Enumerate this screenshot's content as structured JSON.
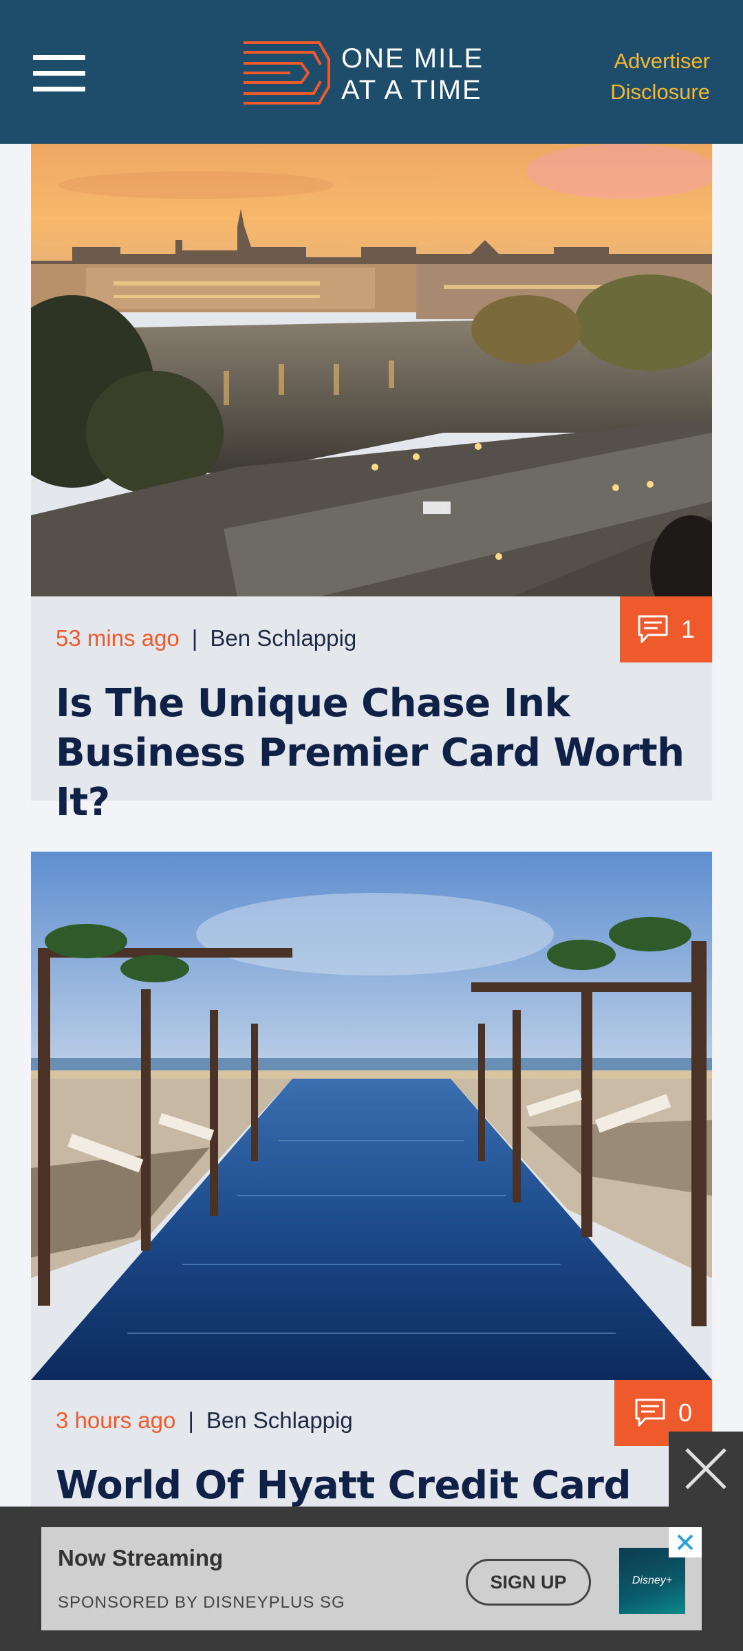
{
  "header": {
    "brand_line1": "ONE MILE",
    "brand_line2": "AT A TIME",
    "advertiser_line1": "Advertiser",
    "advertiser_line2": "Disclosure"
  },
  "articles": [
    {
      "time": "53 mins ago",
      "separator": "|",
      "author": "Ben Schlappig",
      "comments": "1",
      "title_line1": "Is The Unique Chase Ink",
      "title_line2": "Business Premier Card Worth It?",
      "image": "paris-seine-sunset"
    },
    {
      "time": "3 hours ago",
      "separator": "|",
      "author": "Ben Schlappig",
      "comments": "0",
      "title_line1": "World Of Hyatt Credit Card",
      "image": "resort-pool-cabanas"
    }
  ],
  "ad": {
    "title": "Now Streaming",
    "sponsor": "SPONSORED BY DISNEYPLUS SG",
    "cta": "SIGN UP",
    "brand": "Disney+"
  },
  "colors": {
    "header_bg": "#1e4d6b",
    "accent": "#ee5a2c",
    "advertiser": "#f5b731",
    "title": "#0f2147"
  }
}
